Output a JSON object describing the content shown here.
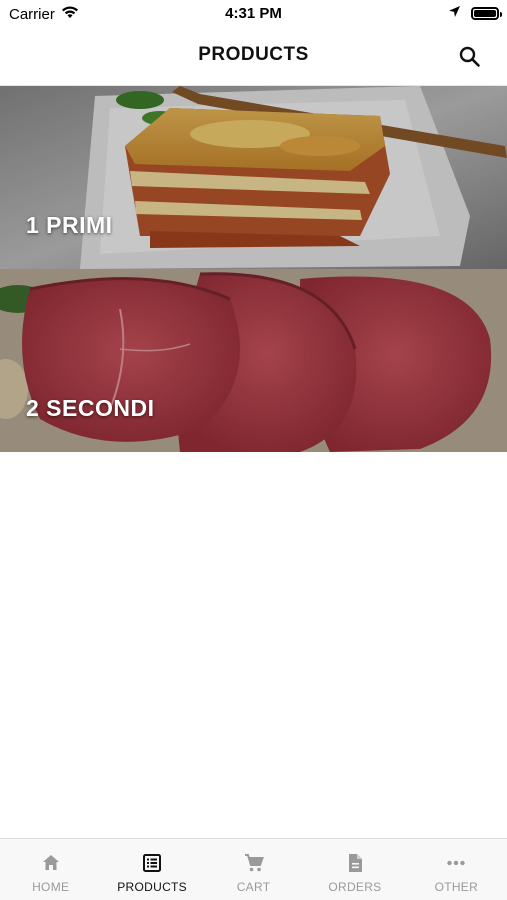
{
  "status_bar": {
    "carrier": "Carrier",
    "time": "4:31 PM"
  },
  "header": {
    "title": "PRODUCTS"
  },
  "categories": [
    {
      "label": "1 PRIMI",
      "image": "lasagna-photo"
    },
    {
      "label": "2 SECONDI",
      "image": "raw-beef-photo"
    }
  ],
  "tab_bar": {
    "active": "PRODUCTS",
    "tabs": [
      {
        "label": "HOME",
        "icon": "home-icon"
      },
      {
        "label": "PRODUCTS",
        "icon": "list-icon"
      },
      {
        "label": "CART",
        "icon": "cart-icon"
      },
      {
        "label": "ORDERS",
        "icon": "document-icon"
      },
      {
        "label": "OTHER",
        "icon": "more-icon"
      }
    ]
  },
  "colors": {
    "active_tab": "#111111",
    "inactive_tab": "#9a9a9a",
    "tab_bar_bg": "#f8f8f8"
  }
}
